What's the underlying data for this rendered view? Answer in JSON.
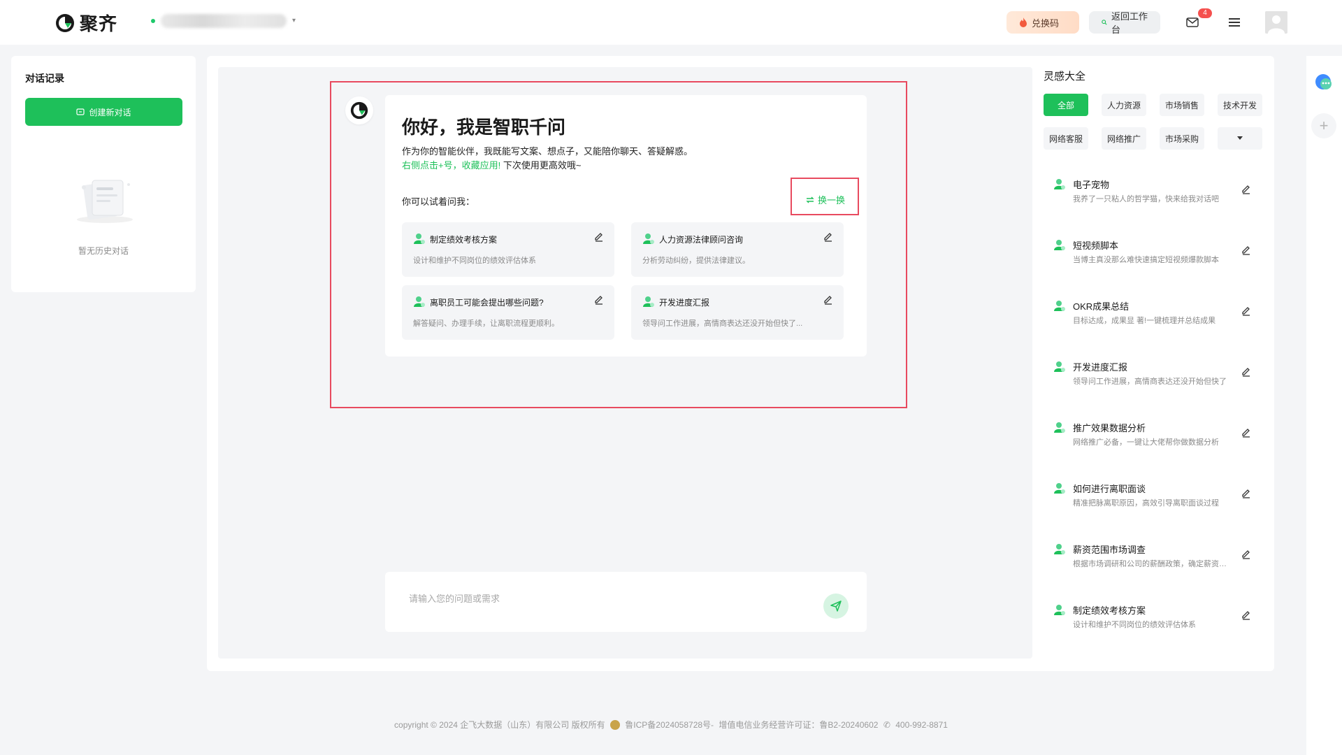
{
  "header": {
    "logo_text": "聚齐",
    "exchange_label": "兑换码",
    "back_label": "返回工作台",
    "mail_badge": "4"
  },
  "history": {
    "title": "对话记录",
    "new_chat_label": "创建新对话",
    "empty_text": "暂无历史对话"
  },
  "welcome": {
    "title": "你好，我是智职千问",
    "desc": "作为你的智能伙伴，我既能写文案、想点子，又能陪你聊天、答疑解惑。",
    "link_text": "右侧点击+号，收藏应用!",
    "desc_suffix": "下次使用更高效哦~",
    "try_label": "你可以试着问我：",
    "swap_label": "换一换",
    "cards": [
      {
        "title": "制定绩效考核方案",
        "desc": "设计和维护不同岗位的绩效评估体系"
      },
      {
        "title": "人力资源法律顾问咨询",
        "desc": "分析劳动纠纷，提供法律建议。"
      },
      {
        "title": "离职员工可能会提出哪些问题?",
        "desc": "解答疑问、办理手续，让离职流程更顺利。"
      },
      {
        "title": "开发进度汇报",
        "desc": "领导问工作进展，高情商表达还没开始但快了..."
      }
    ]
  },
  "input": {
    "placeholder": "请输入您的问题或需求"
  },
  "inspiration": {
    "title": "灵感大全",
    "categories": [
      "全部",
      "人力资源",
      "市场销售",
      "技术开发",
      "网络客服",
      "网络推广",
      "市场采购"
    ],
    "items": [
      {
        "title": "电子宠物",
        "desc": "我养了一只粘人的哲学猫，快来给我对话吧"
      },
      {
        "title": "短视频脚本",
        "desc": "当博主真没那么难快速搞定短视频爆款脚本"
      },
      {
        "title": "OKR成果总结",
        "desc": "目标达成，成果显 著!一键梳理并总结成果"
      },
      {
        "title": "开发进度汇报",
        "desc": "领导问工作进展，高情商表达还没开始但快了"
      },
      {
        "title": "推广效果数据分析",
        "desc": "网络推广必备，一键让大佬帮你做数据分析"
      },
      {
        "title": "如何进行离职面谈",
        "desc": "精准把脉离职原因，高效引导离职面谈过程"
      },
      {
        "title": "薪资范围市场调查",
        "desc": "根据市场调研和公司的薪酬政策，确定薪资范围"
      },
      {
        "title": "制定绩效考核方案",
        "desc": "设计和维护不同岗位的绩效评估体系"
      }
    ]
  },
  "footer": {
    "copyright": "copyright © 2024 企飞大数据（山东）有限公司 版权所有",
    "icp": "鲁ICP备2024058728号-",
    "license": "增值电信业务经营许可证：鲁B2-20240602",
    "phone": "400-992-8871"
  },
  "colors": {
    "brand_green": "#1ec05a",
    "highlight_red": "#e84a5f"
  }
}
